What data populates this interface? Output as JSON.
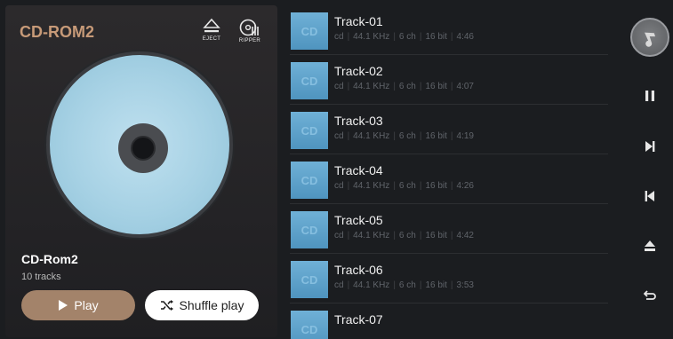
{
  "player": {
    "title": "CD-ROM2",
    "eject_label": "EJECT",
    "ripper_label": "RIPPER",
    "album_name": "CD-Rom2",
    "track_count": "10 tracks",
    "play_label": "Play",
    "shuffle_label": "Shuffle play",
    "accent_color": "#a3836a"
  },
  "tracks": [
    {
      "title": "Track-01",
      "thumb": "CD",
      "source": "cd",
      "rate": "44.1 KHz",
      "channels": "6 ch",
      "depth": "16 bit",
      "duration": "4:46"
    },
    {
      "title": "Track-02",
      "thumb": "CD",
      "source": "cd",
      "rate": "44.1 KHz",
      "channels": "6 ch",
      "depth": "16 bit",
      "duration": "4:07"
    },
    {
      "title": "Track-03",
      "thumb": "CD",
      "source": "cd",
      "rate": "44.1 KHz",
      "channels": "6 ch",
      "depth": "16 bit",
      "duration": "4:19"
    },
    {
      "title": "Track-04",
      "thumb": "CD",
      "source": "cd",
      "rate": "44.1 KHz",
      "channels": "6 ch",
      "depth": "16 bit",
      "duration": "4:26"
    },
    {
      "title": "Track-05",
      "thumb": "CD",
      "source": "cd",
      "rate": "44.1 KHz",
      "channels": "6 ch",
      "depth": "16 bit",
      "duration": "4:42"
    },
    {
      "title": "Track-06",
      "thumb": "CD",
      "source": "cd",
      "rate": "44.1 KHz",
      "channels": "6 ch",
      "depth": "16 bit",
      "duration": "3:53"
    },
    {
      "title": "Track-07",
      "thumb": "CD",
      "source": "",
      "rate": "",
      "channels": "",
      "depth": "",
      "duration": ""
    }
  ],
  "controls": {
    "icons": [
      "music-note-icon",
      "pause-icon",
      "next-track-icon",
      "previous-track-icon",
      "eject-icon",
      "back-icon"
    ]
  }
}
